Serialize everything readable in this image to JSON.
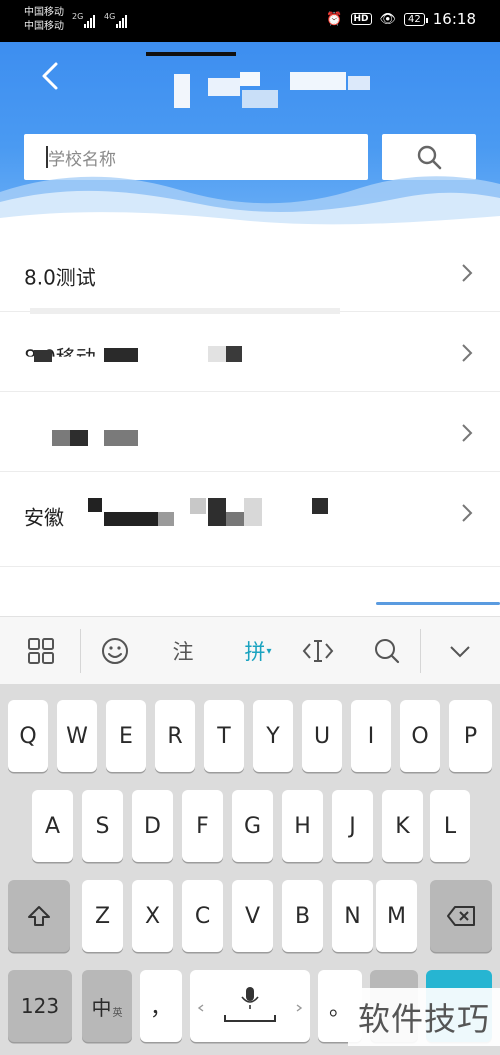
{
  "status_bar": {
    "carrier_1": "中国移动",
    "carrier_2": "中国移动",
    "signal_1": "2G",
    "signal_2": "4G",
    "battery": "42",
    "time": "16:18",
    "icons": [
      "alarm-icon",
      "hd-icon",
      "eye-icon",
      "battery-icon"
    ]
  },
  "header": {
    "back_icon": "back-arrow-icon",
    "search_placeholder": "学校名称",
    "search_icon": "search-icon",
    "accent_color": "#4a9af2"
  },
  "list": {
    "items": [
      {
        "label": "8.0测试"
      },
      {
        "label": "8.0移动"
      },
      {
        "label": ""
      },
      {
        "label": "安徽"
      }
    ]
  },
  "keyboard_toolbar": {
    "annotate_label": "注",
    "pinyin_label": "拼",
    "pinyin_color": "#1aa3c0",
    "icons": [
      "grid-menu-icon",
      "emoji-icon",
      "cursor-move-icon",
      "search-icon",
      "collapse-icon"
    ]
  },
  "keyboard": {
    "row1": [
      "Q",
      "W",
      "E",
      "R",
      "T",
      "Y",
      "U",
      "I",
      "O",
      "P"
    ],
    "row2": [
      "A",
      "S",
      "D",
      "F",
      "G",
      "H",
      "J",
      "K",
      "L"
    ],
    "row3": [
      "Z",
      "X",
      "C",
      "V",
      "B",
      "N",
      "M"
    ],
    "numbers_label": "123",
    "lang_label": "中",
    "lang_sub": "英",
    "comma": "，",
    "period": "。"
  },
  "watermark": "软件技巧"
}
